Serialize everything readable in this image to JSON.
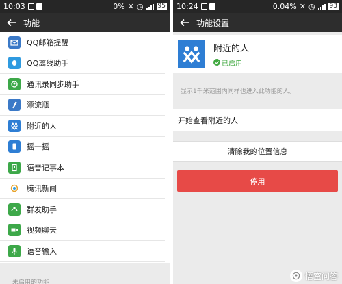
{
  "left": {
    "status": {
      "time": "10:03",
      "percent": "0%",
      "battery": "95"
    },
    "title": "功能",
    "items": [
      {
        "label": "QQ邮箱提醒",
        "icon": "mail-icon",
        "color": "#3b79c7"
      },
      {
        "label": "QQ离线助手",
        "icon": "qq-icon",
        "color": "#2e9ae0"
      },
      {
        "label": "通讯录同步助手",
        "icon": "sync-icon",
        "color": "#3da849"
      },
      {
        "label": "漂流瓶",
        "icon": "bottle-icon",
        "color": "#3b79c7"
      },
      {
        "label": "附近的人",
        "icon": "people-nearby-icon",
        "color": "#2e7ed4"
      },
      {
        "label": "摇一摇",
        "icon": "shake-icon",
        "color": "#2e7ed4"
      },
      {
        "label": "语音记事本",
        "icon": "voice-note-icon",
        "color": "#3da849"
      },
      {
        "label": "腾讯新闻",
        "icon": "news-icon",
        "color": "#e8a42c"
      },
      {
        "label": "群发助手",
        "icon": "broadcast-icon",
        "color": "#3da849"
      },
      {
        "label": "视频聊天",
        "icon": "video-icon",
        "color": "#3da849"
      },
      {
        "label": "语音输入",
        "icon": "mic-icon",
        "color": "#3da849"
      }
    ],
    "section_label": "未启用的功能"
  },
  "right": {
    "status": {
      "time": "10:24",
      "percent": "0.04%",
      "battery": "93"
    },
    "title": "功能设置",
    "feature_name": "附近的人",
    "enabled_text": "已启用",
    "description": "显示1千米范围内同样也进入此功能的人。",
    "view_label": "开始查看附近的人",
    "clear_label": "清除我的位置信息",
    "disable_label": "停用"
  },
  "watermark": "悟空问答",
  "colors": {
    "accent_red": "#e74a47",
    "status_green": "#3fa83f",
    "titlebar": "#2d2d2d"
  }
}
